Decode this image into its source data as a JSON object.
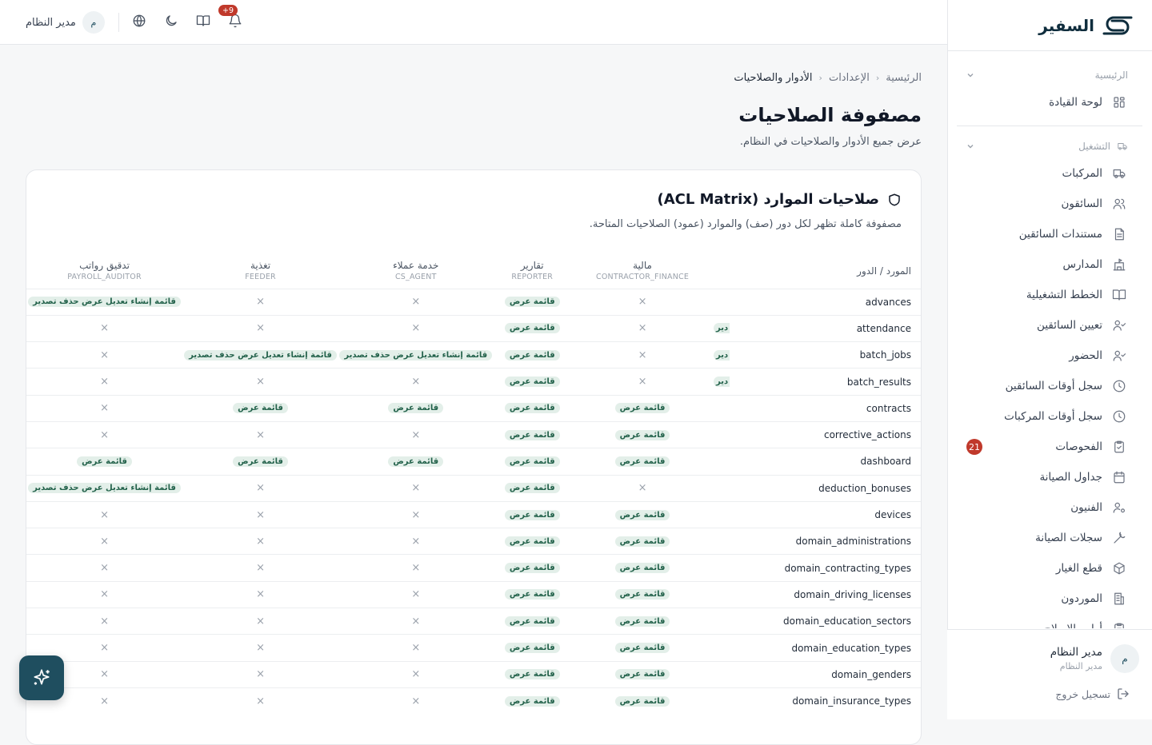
{
  "brand": {
    "name": "السفير"
  },
  "topbar": {
    "user_name": "مدير النظام",
    "avatar_initial": "م",
    "notif_count": "+9"
  },
  "breadcrumb": [
    "الرئيسية",
    "الإعدادات",
    "الأدوار والصلاحيات"
  ],
  "page": {
    "title": "مصفوفة الصلاحيات",
    "subtitle": "عرض جميع الأدوار والصلاحيات في النظام."
  },
  "card": {
    "title": "صلاحيات الموارد (ACL Matrix)",
    "description": "مصفوفة كاملة تظهر لكل دور (صف) والموارد (عمود) الصلاحيات المتاحة."
  },
  "sidebar": {
    "sections": [
      {
        "title": "الرئيسية",
        "items": [
          {
            "label": "لوحة القيادة",
            "icon": "dashboard-icon"
          }
        ]
      },
      {
        "title": "التشغيل",
        "items": [
          {
            "label": "المركبات",
            "icon": "truck-icon"
          },
          {
            "label": "السائقون",
            "icon": "users-icon"
          },
          {
            "label": "مستندات السائقين",
            "icon": "document-icon"
          },
          {
            "label": "المدارس",
            "icon": "school-icon"
          },
          {
            "label": "الخطط التشغيلية",
            "icon": "book-icon"
          },
          {
            "label": "تعيين السائقين",
            "icon": "user-check-icon"
          },
          {
            "label": "الحضور",
            "icon": "user-check-icon"
          },
          {
            "label": "سجل أوقات السائقين",
            "icon": "clock-icon"
          },
          {
            "label": "سجل أوقات المركبات",
            "icon": "clock-icon"
          },
          {
            "label": "الفحوصات",
            "icon": "clipboard-check-icon",
            "badge": "21"
          },
          {
            "label": "جداول الصيانة",
            "icon": "calendar-icon"
          },
          {
            "label": "الفنيون",
            "icon": "user-cog-icon"
          },
          {
            "label": "سجلات الصيانة",
            "icon": "wrench-icon"
          },
          {
            "label": "قطع الغيار",
            "icon": "package-icon"
          },
          {
            "label": "الموردون",
            "icon": "building-icon"
          },
          {
            "label": "أوامر الإصلاح",
            "icon": "clipboard-icon"
          }
        ]
      }
    ],
    "footer": {
      "user_name": "مدير النظام",
      "user_role": "مدير النظام",
      "avatar_initial": "م",
      "logout": "تسجيل خروج"
    }
  },
  "matrix": {
    "resource_header": "المورد / الدور",
    "roles": [
      {
        "ar": "مالية",
        "code": "CONTRACTOR_FINANCE"
      },
      {
        "ar": "تقارير",
        "code": "REPORTER"
      },
      {
        "ar": "خدمة عملاء",
        "code": "CS_AGENT"
      },
      {
        "ar": "تغذية",
        "code": "FEEDER"
      },
      {
        "ar": "تدقيق رواتب",
        "code": "PAYROLL_AUDITOR"
      }
    ],
    "clip_text": "دير",
    "rows": [
      {
        "resource": "advances",
        "clip": false,
        "cells": [
          "×",
          "قائمة عرض",
          "×",
          "×",
          "قائمة إنشاء تعديل عرض حذف تصدير"
        ]
      },
      {
        "resource": "attendance",
        "clip": true,
        "cells": [
          "×",
          "قائمة عرض",
          "×",
          "×",
          "×"
        ]
      },
      {
        "resource": "batch_jobs",
        "clip": true,
        "cells": [
          "×",
          "قائمة عرض",
          "قائمة إنشاء تعديل عرض حذف تصدير",
          "قائمة إنشاء تعديل عرض حذف تصدير",
          "×"
        ]
      },
      {
        "resource": "batch_results",
        "clip": true,
        "cells": [
          "×",
          "قائمة عرض",
          "×",
          "×",
          "×"
        ]
      },
      {
        "resource": "contracts",
        "clip": false,
        "cells": [
          "قائمة عرض",
          "قائمة عرض",
          "قائمة عرض",
          "قائمة عرض",
          "×"
        ]
      },
      {
        "resource": "corrective_actions",
        "clip": false,
        "cells": [
          "قائمة عرض",
          "قائمة عرض",
          "×",
          "×",
          "×"
        ]
      },
      {
        "resource": "dashboard",
        "clip": false,
        "cells": [
          "قائمة عرض",
          "قائمة عرض",
          "قائمة عرض",
          "قائمة عرض",
          "قائمة عرض"
        ]
      },
      {
        "resource": "deduction_bonuses",
        "clip": false,
        "cells": [
          "×",
          "قائمة عرض",
          "×",
          "×",
          "قائمة إنشاء تعديل عرض حذف تصدير"
        ]
      },
      {
        "resource": "devices",
        "clip": false,
        "cells": [
          "قائمة عرض",
          "قائمة عرض",
          "×",
          "×",
          "×"
        ]
      },
      {
        "resource": "domain_administrations",
        "clip": false,
        "cells": [
          "قائمة عرض",
          "قائمة عرض",
          "×",
          "×",
          "×"
        ]
      },
      {
        "resource": "domain_contracting_types",
        "clip": false,
        "cells": [
          "قائمة عرض",
          "قائمة عرض",
          "×",
          "×",
          "×"
        ]
      },
      {
        "resource": "domain_driving_licenses",
        "clip": false,
        "cells": [
          "قائمة عرض",
          "قائمة عرض",
          "×",
          "×",
          "×"
        ]
      },
      {
        "resource": "domain_education_sectors",
        "clip": false,
        "cells": [
          "قائمة عرض",
          "قائمة عرض",
          "×",
          "×",
          "×"
        ]
      },
      {
        "resource": "domain_education_types",
        "clip": false,
        "cells": [
          "قائمة عرض",
          "قائمة عرض",
          "×",
          "×",
          "×"
        ]
      },
      {
        "resource": "domain_genders",
        "clip": false,
        "cells": [
          "قائمة عرض",
          "قائمة عرض",
          "×",
          "×",
          "×"
        ]
      },
      {
        "resource": "domain_insurance_types",
        "clip": false,
        "cells": [
          "قائمة عرض",
          "قائمة عرض",
          "×",
          "×",
          "×"
        ]
      }
    ]
  },
  "colors": {
    "brand": "#1f4e5f",
    "pill_bg": "#e3efe9",
    "pill_text": "#23624b",
    "badge": "#c0392b"
  }
}
